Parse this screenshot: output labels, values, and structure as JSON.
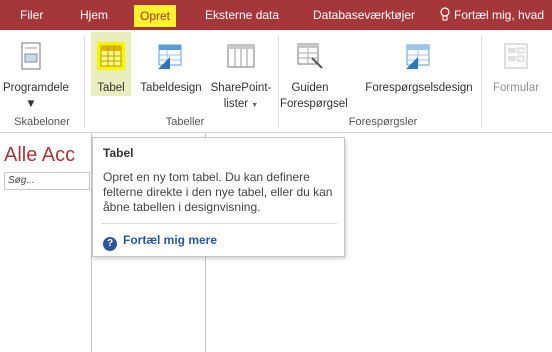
{
  "tabs": [
    "Filer",
    "Hjem",
    "Opret",
    "Eksterne data",
    "Databaseværktøjer"
  ],
  "tell_me": "Fortæl mig, hvad",
  "ribbon": {
    "programdele": "Programdele",
    "tabel": "Tabel",
    "tabeldesign": "Tabeldesign",
    "sharepoint_line1": "SharePoint-",
    "sharepoint_line2": "lister",
    "guiden_line1": "Guiden",
    "guiden_line2": "Forespørgsel",
    "foresporgselsdesign": "Forespørgselsdesign",
    "formular": "Formular",
    "groups": {
      "skabeloner": "Skabeloner",
      "tabeller": "Tabeller",
      "foresporgsler": "Forespørgsler"
    }
  },
  "nav": {
    "title": "Alle Acc",
    "search_placeholder": "Søg..."
  },
  "tooltip": {
    "title": "Tabel",
    "body": "Opret en ny tom tabel. Du kan definere felterne direkte i den nye tabel, eller du kan åbne tabellen i designvisning.",
    "help_link": "Fortæl mig mere"
  },
  "colors": {
    "accent": "#a4373a",
    "highlight": "#fff22f",
    "link": "#2b579a"
  }
}
